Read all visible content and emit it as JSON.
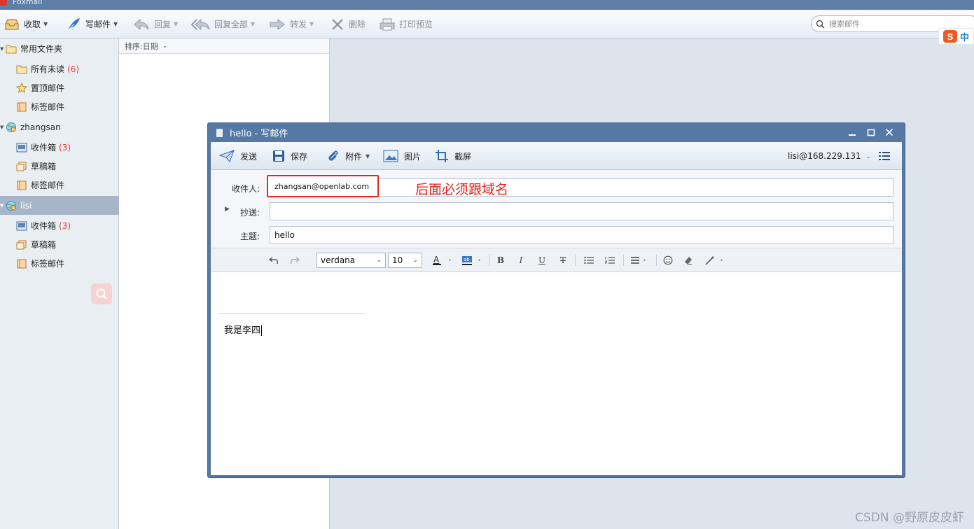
{
  "app": {
    "title": "Foxmail"
  },
  "toolbar": {
    "receive": "收取",
    "compose": "写邮件",
    "reply": "回复",
    "reply_all": "回复全部",
    "forward": "转发",
    "delete": "删除",
    "print_preview": "打印预览",
    "search_placeholder": "搜索邮件"
  },
  "ime": {
    "logo": "S",
    "mode": "中"
  },
  "sidebar": {
    "common": {
      "label": "常用文件夹",
      "items": [
        {
          "label": "所有未读",
          "count": "(6)"
        },
        {
          "label": "置顶邮件"
        },
        {
          "label": "标签邮件"
        }
      ]
    },
    "accounts": [
      {
        "name": "zhangsan",
        "items": [
          {
            "label": "收件箱",
            "count": "(3)"
          },
          {
            "label": "草稿箱"
          },
          {
            "label": "标签邮件"
          }
        ]
      },
      {
        "name": "lisi",
        "items": [
          {
            "label": "收件箱",
            "count": "(3)"
          },
          {
            "label": "草稿箱"
          },
          {
            "label": "标签邮件"
          }
        ]
      }
    ]
  },
  "list": {
    "sort_label": "排序:日期"
  },
  "compose": {
    "title": "hello - 写邮件",
    "toolbar": {
      "send": "发送",
      "save": "保存",
      "attach": "附件",
      "image": "图片",
      "screenshot": "截屏",
      "account": "lisi@168.229.131"
    },
    "fields": {
      "to_label": "收件人:",
      "to_value": "zhangsan@openlab.com",
      "cc_label": "抄送:",
      "cc_value": "",
      "subject_label": "主题:",
      "subject_value": "hello"
    },
    "annotation": "后面必须跟域名",
    "format": {
      "font": "verdana",
      "size": "10"
    },
    "body": "我是李四"
  },
  "watermark": "CSDN @野原皮皮虾",
  "colors": {
    "accent": "#5578a4",
    "annotation_red": "#e32b22",
    "count_red": "#e23b2e"
  }
}
